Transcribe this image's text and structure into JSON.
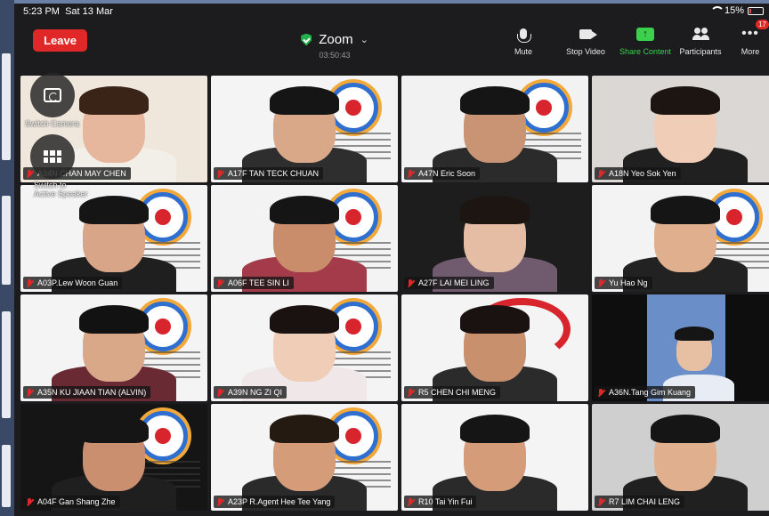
{
  "status_bar": {
    "time": "5:23 PM",
    "date": "Sat 13 Mar",
    "battery": "15%",
    "battery_level": 0.15
  },
  "header": {
    "leave_label": "Leave",
    "app_title": "Zoom",
    "duration": "03:50:43"
  },
  "toolbar": {
    "mute_label": "Mute",
    "stop_video_label": "Stop Video",
    "share_label": "Share Content",
    "participants_label": "Participants",
    "more_label": "More",
    "more_badge": "17"
  },
  "overlay": {
    "switch_camera_label": "Switch Camera",
    "switch_speaker_label_1": "Switch to",
    "switch_speaker_label_2": "Active Speaker"
  },
  "participants": [
    {
      "name": "A34N CHAN MAY CHEN"
    },
    {
      "name": "A17F TAN TECK CHUAN"
    },
    {
      "name": "A47N Eric Soon"
    },
    {
      "name": "A18N Yeo Sok Yen"
    },
    {
      "name": "A03P.Lew Woon Guan"
    },
    {
      "name": "A06F TEE SIN LI"
    },
    {
      "name": "A27F LAI MEI LING"
    },
    {
      "name": "Yu Hao Ng"
    },
    {
      "name": "A35N KU JIAAN TIAN (ALVIN)"
    },
    {
      "name": "A39N NG ZI QI"
    },
    {
      "name": "R5 CHEN CHI MENG"
    },
    {
      "name": "A36N.Tang Gim Kuang"
    },
    {
      "name": "A04F Gan Shang Zhe"
    },
    {
      "name": "A23P R.Agent Hee Tee Yang"
    },
    {
      "name": "R10 Tai Yin Fui"
    },
    {
      "name": "R7 LIM CHAI LENG"
    }
  ],
  "colors": {
    "leave": "#e02828",
    "share": "#3bd14c",
    "secure": "#22b24c",
    "muted": "#e02828"
  }
}
